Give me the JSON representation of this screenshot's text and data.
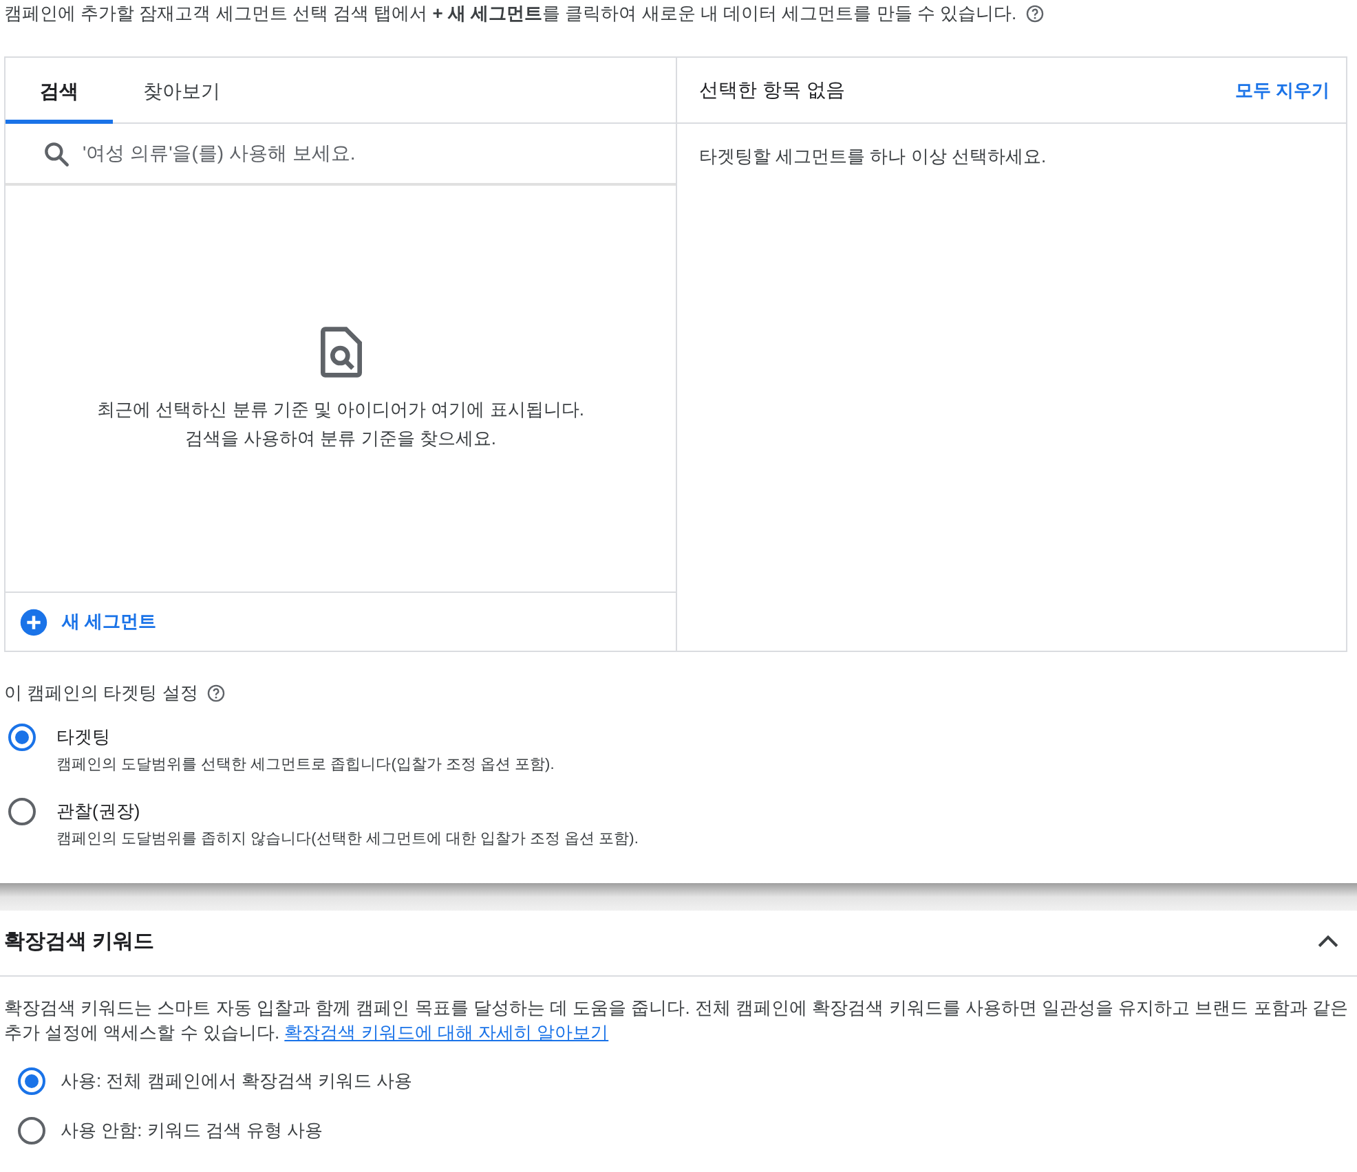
{
  "intro": "캠페인에 추가할 잠재고객 세그먼트 선택 검색 탭에서 **+ 새 세그먼트**를 클릭하여 새로운 내 데이터 세그먼트를 만들 수 있습니다.",
  "segment_picker": {
    "tabs": [
      {
        "label": "검색",
        "selected": true
      },
      {
        "label": "찾아보기",
        "selected": false
      }
    ],
    "search": {
      "placeholder": "'여성 의류'을(를) 사용해 보세요."
    },
    "empty_message": [
      "최근에 선택하신 분류 기준 및 아이디어가 여기에 표시됩니다.",
      "검색을 사용하여 분류 기준을 찾으세요."
    ],
    "new_segment_button": "새 세그먼트",
    "selected_title": "선택한 항목 없음",
    "clear_all": "모두 지우기",
    "selected_hint": "타겟팅할 세그먼트를 하나 이상 선택하세요."
  },
  "targeting_setting": {
    "title": "이 캠페인의 타겟팅 설정",
    "options": [
      {
        "label": "타겟팅",
        "description": "캠페인의 도달범위를 선택한 세그먼트로 좁힙니다(입찰가 조정 옵션 포함).",
        "selected": true
      },
      {
        "label": "관찰(권장)",
        "description": "캠페인의 도달범위를 좁히지 않습니다(선택한 세그먼트에 대한 입찰가 조정 옵션 포함).",
        "selected": false
      }
    ]
  },
  "broad_match": {
    "title": "확장검색 키워드",
    "expanded": true,
    "description": "확장검색 키워드는 스마트 자동 입찰과 함께 캠페인 목표를 달성하는 데 도움을 줍니다. 전체 캠페인에 확장검색 키워드를 사용하면 일관성을 유지하고 브랜드 포함과 같은 추가 설정에 액세스할 수 있습니다.",
    "link": "확장검색 키워드에 대해 자세히 알아보기",
    "options": [
      {
        "label": "사용: 전체 캠페인에서 확장검색 키워드 사용",
        "selected": true
      },
      {
        "label": "사용 안함: 키워드 검색 유형 사용",
        "selected": false
      }
    ]
  }
}
